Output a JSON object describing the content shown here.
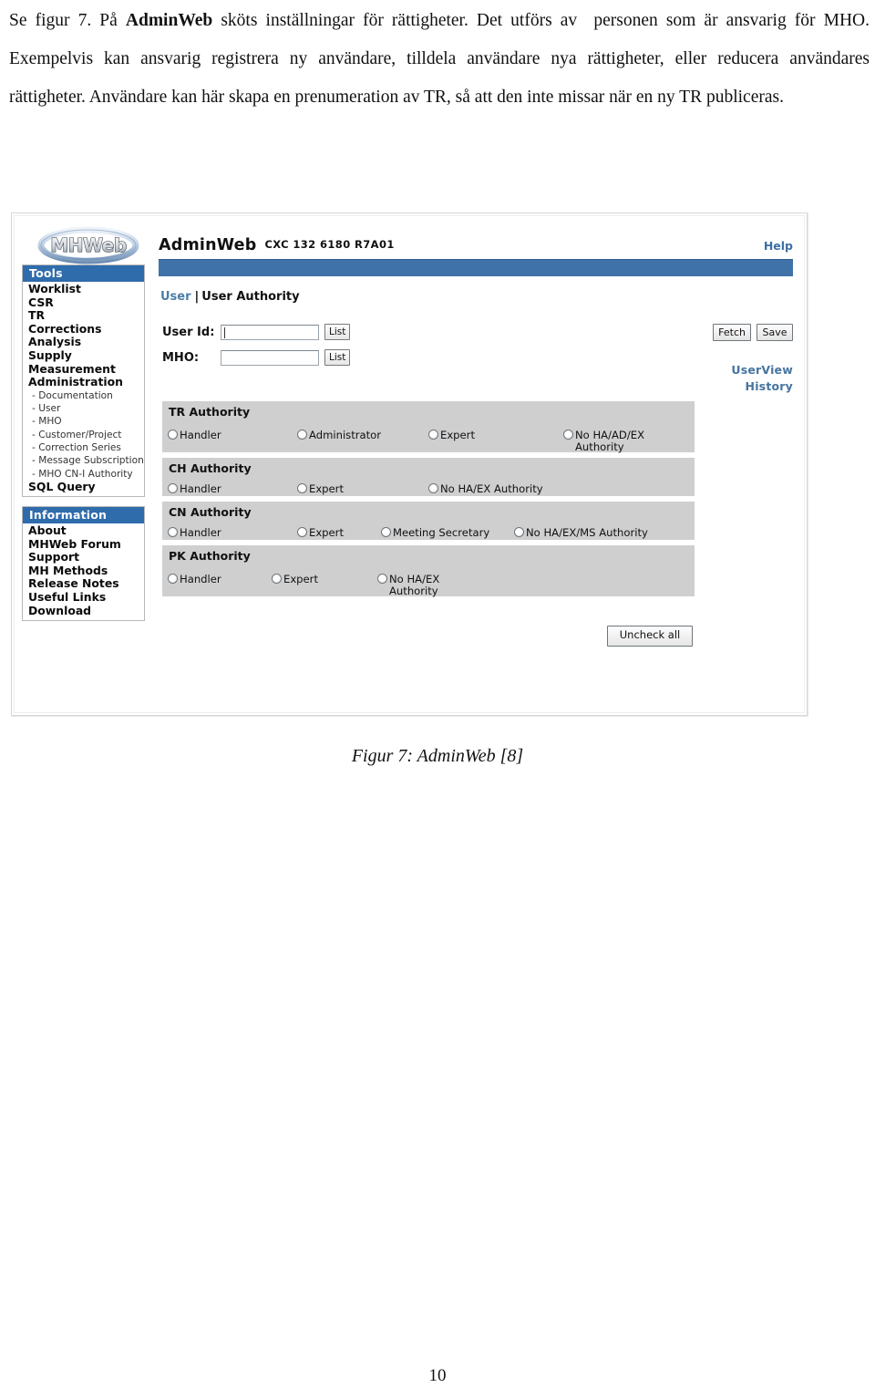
{
  "document": {
    "paragraph_html": "Se figur 7. På <b>AdminWeb</b> sköts inställningar för rättigheter. Det utförs av&nbsp; personen som är ansvarig för MHO. Exempelvis kan ansvarig registrera ny användare, tilldela användare nya rättigheter, eller reducera användares rättigheter. Användare kan här skapa en prenumeration av TR, så att den inte missar när en ny TR publiceras.",
    "caption": "Figur 7: AdminWeb [8]",
    "page_number": "10"
  },
  "app": {
    "logo_text": "MHWeb",
    "title": "AdminWeb",
    "version": "CXC 132 6180 R7A01",
    "help_label": "Help",
    "breadcrumb": {
      "link": "User",
      "separator": "|",
      "current": "User Authority"
    },
    "form": {
      "user_id": {
        "label": "User Id:",
        "value": "",
        "list_button": "List"
      },
      "mho": {
        "label": "MHO:",
        "value": "",
        "list_button": "List"
      }
    },
    "actions": {
      "fetch": "Fetch",
      "save": "Save",
      "uncheck_all": "Uncheck all"
    },
    "side_links": [
      "UserView",
      "History"
    ],
    "authorities": [
      {
        "title": "TR Authority",
        "options": [
          "Handler",
          "Administrator",
          "Expert",
          "No HA/AD/EX\nAuthority"
        ]
      },
      {
        "title": "CH Authority",
        "options": [
          "Handler",
          "Expert",
          "No HA/EX Authority"
        ]
      },
      {
        "title": "CN Authority",
        "options": [
          "Handler",
          "Expert",
          "Meeting Secretary",
          "No HA/EX/MS Authority"
        ]
      },
      {
        "title": "PK Authority",
        "options": [
          "Handler",
          "Expert",
          "No HA/EX\nAuthority"
        ]
      }
    ],
    "sidebar": {
      "tools": {
        "header": "Tools",
        "items": [
          {
            "label": "Worklist",
            "sub": false
          },
          {
            "label": "CSR",
            "sub": false
          },
          {
            "label": "TR",
            "sub": false
          },
          {
            "label": "Corrections",
            "sub": false
          },
          {
            "label": "Analysis",
            "sub": false
          },
          {
            "label": "Supply",
            "sub": false
          },
          {
            "label": "Measurement",
            "sub": false
          },
          {
            "label": "Administration",
            "sub": false
          },
          {
            "label": "- Documentation",
            "sub": true
          },
          {
            "label": "- User",
            "sub": true
          },
          {
            "label": "- MHO",
            "sub": true
          },
          {
            "label": "- Customer/Project",
            "sub": true
          },
          {
            "label": "- Correction Series",
            "sub": true
          },
          {
            "label": "- Message Subscription",
            "sub": true
          },
          {
            "label": "- MHO CN-I Authority",
            "sub": true
          },
          {
            "label": "SQL Query",
            "sub": false
          }
        ]
      },
      "information": {
        "header": "Information",
        "items": [
          {
            "label": "About",
            "sub": false
          },
          {
            "label": "MHWeb Forum",
            "sub": false
          },
          {
            "label": "Support",
            "sub": false
          },
          {
            "label": "MH Methods",
            "sub": false
          },
          {
            "label": "Release Notes",
            "sub": false
          },
          {
            "label": "Useful Links",
            "sub": false
          },
          {
            "label": "Download",
            "sub": false
          }
        ]
      }
    }
  },
  "colors": {
    "header_blue": "#3f72a8",
    "panel_header_blue": "#2f6cab",
    "link_blue": "#46749f",
    "authority_gray": "#cfcfcf"
  }
}
